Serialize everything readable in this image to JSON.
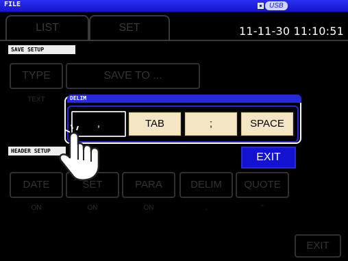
{
  "titlebar": {
    "title": "FILE",
    "storage_label": "USB",
    "storage_icon": "drive-icon"
  },
  "tabs": [
    {
      "label": "LIST"
    },
    {
      "label": "SET"
    }
  ],
  "clock": "11-11-30 11:10:51",
  "save_setup": {
    "section_label": "SAVE SETUP",
    "type_button": "TYPE",
    "type_value": "TEXT",
    "save_to_button": "SAVE TO ..."
  },
  "header_setup": {
    "section_label": "HEADER SETUP",
    "buttons": [
      {
        "label": "DATE",
        "value": "ON"
      },
      {
        "label": "SET",
        "value": "ON"
      },
      {
        "label": "PARA",
        "value": "ON"
      },
      {
        "label": "DELIM",
        "value": ","
      },
      {
        "label": "QUOTE",
        "value": "\""
      }
    ]
  },
  "exit_background": "EXIT",
  "delim_dialog": {
    "title": "DELIM",
    "options": [
      {
        "label": ",",
        "selected": true
      },
      {
        "label": "TAB",
        "selected": false
      },
      {
        "label": ";",
        "selected": false
      },
      {
        "label": "SPACE",
        "selected": false
      }
    ],
    "exit_button": "EXIT"
  },
  "colors": {
    "title_bar": "#1e1ee0",
    "option_button": "#f4e6c4",
    "exit_button": "#1212d0",
    "screen": "#000000"
  },
  "pointer_icon": "tapping-hand-icon"
}
